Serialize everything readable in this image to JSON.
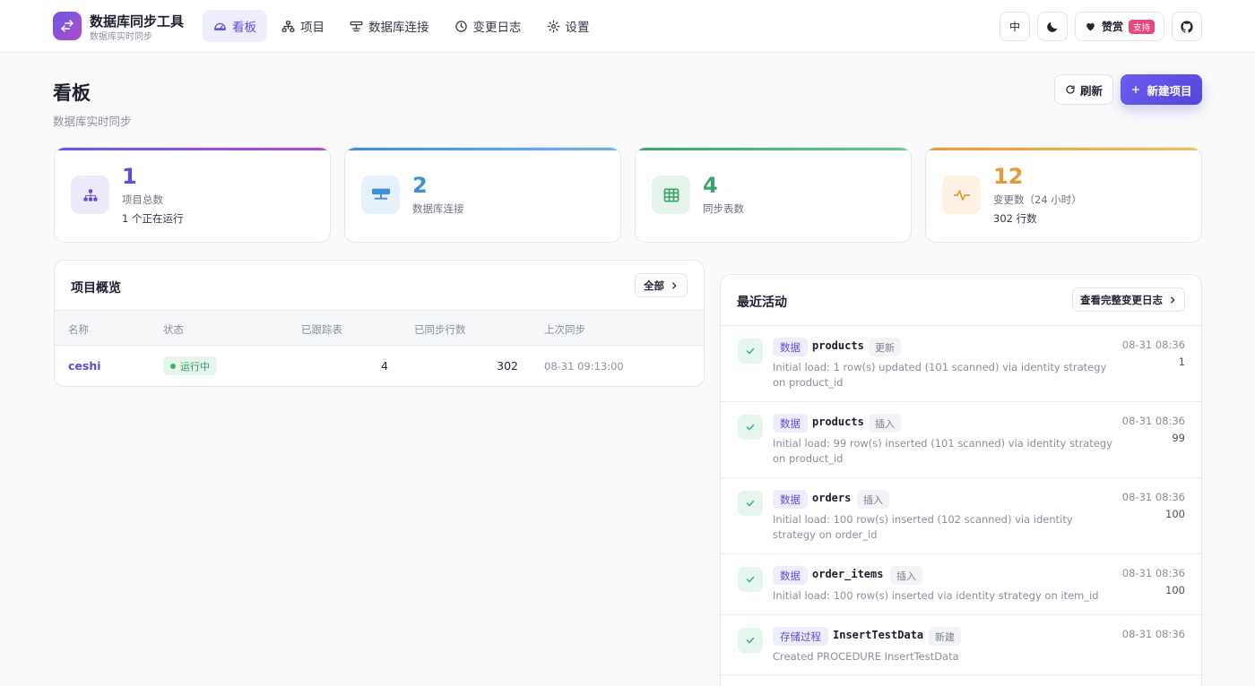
{
  "app": {
    "title": "数据库同步工具",
    "subtitle": "数据库实时同步"
  },
  "nav": [
    {
      "label": "看板",
      "icon": "dashboard-icon",
      "active": true
    },
    {
      "label": "项目",
      "icon": "sitemap-icon",
      "active": false
    },
    {
      "label": "数据库连接",
      "icon": "server-icon",
      "active": false
    },
    {
      "label": "变更日志",
      "icon": "clock-icon",
      "active": false
    },
    {
      "label": "设置",
      "icon": "gear-icon",
      "active": false
    }
  ],
  "header_actions": {
    "language": "中",
    "donate_label": "赞赏",
    "support_badge": "支持"
  },
  "page": {
    "title": "看板",
    "subtitle": "数据库实时同步",
    "refresh_label": "刷新",
    "new_project_label": "新建项目"
  },
  "stats": [
    {
      "value": "1",
      "label": "项目总数",
      "extra": "1 个正在运行",
      "color": "#5b4fd9"
    },
    {
      "value": "2",
      "label": "数据库连接",
      "extra": "",
      "color": "#3d8fd6"
    },
    {
      "value": "4",
      "label": "同步表数",
      "extra": "",
      "color": "#3aa56a"
    },
    {
      "value": "12",
      "label": "变更数（24 小时）",
      "extra": "302 行数",
      "color": "#e69a3a"
    }
  ],
  "overview": {
    "title": "项目概览",
    "all_label": "全部",
    "columns": [
      "名称",
      "状态",
      "已跟踪表",
      "已同步行数",
      "上次同步"
    ],
    "rows": [
      {
        "name": "ceshi",
        "status": "运行中",
        "tracked": "4",
        "synced": "302",
        "last_sync": "08-31 09:13:00"
      }
    ]
  },
  "activity": {
    "title": "最近活动",
    "view_all_label": "查看完整变更日志",
    "items": [
      {
        "type": "数据",
        "object": "products",
        "op": "更新",
        "desc": "Initial load: 1 row(s) updated (101 scanned) via identity strategy on product_id",
        "time": "08-31 08:36",
        "count": "1"
      },
      {
        "type": "数据",
        "object": "products",
        "op": "插入",
        "desc": "Initial load: 99 row(s) inserted (101 scanned) via identity strategy on product_id",
        "time": "08-31 08:36",
        "count": "99"
      },
      {
        "type": "数据",
        "object": "orders",
        "op": "插入",
        "desc": "Initial load: 100 row(s) inserted (102 scanned) via identity strategy on order_id",
        "time": "08-31 08:36",
        "count": "100"
      },
      {
        "type": "数据",
        "object": "order_items",
        "op": "插入",
        "desc": "Initial load: 100 row(s) inserted via identity strategy on item_id",
        "time": "08-31 08:36",
        "count": "100"
      },
      {
        "type": "存储过程",
        "object": "InsertTestData",
        "op": "新建",
        "desc": "Created PROCEDURE InsertTestData",
        "time": "08-31 08:36",
        "count": ""
      }
    ]
  },
  "colors": {
    "accent": "#5b4fd9",
    "success": "#3cb56c"
  }
}
